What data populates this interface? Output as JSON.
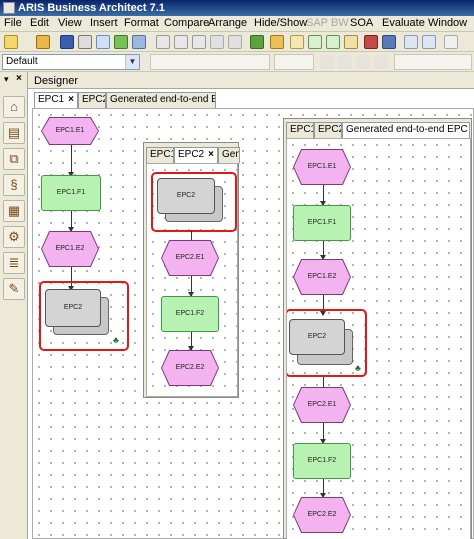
{
  "app": {
    "title": "ARIS Business Architect 7.1"
  },
  "menu": [
    "File",
    "Edit",
    "View",
    "Insert",
    "Format",
    "Compare",
    "Arrange",
    "Hide/Show",
    "SAP BW",
    "SOA",
    "Evaluate",
    "Window"
  ],
  "toolbar": {
    "database_combo": "Default"
  },
  "panel": {
    "title": "Designer"
  },
  "windows": {
    "left": {
      "tabs": [
        "EPC1",
        "EPC2",
        "Generated end-to-end EPC"
      ],
      "close_glyph": "×"
    },
    "middle": {
      "tabs": [
        "EPC1",
        "EPC2",
        "Genera"
      ],
      "close_glyph": "×"
    },
    "right": {
      "tabs": [
        "EPC1",
        "EPC2",
        "Generated end-to-end EPC"
      ],
      "close_glyph": "×"
    }
  },
  "models": {
    "epc1": {
      "nodes": [
        "EPC1.E1",
        "EPC1.F1",
        "EPC1.E2",
        "EPC2"
      ]
    },
    "epc2": {
      "nodes": [
        "EPC2",
        "EPC2.E1",
        "EPC1.F2",
        "EPC2.E2"
      ]
    },
    "generated": {
      "nodes": [
        "EPC1.E1",
        "EPC1.F1",
        "EPC1.E2",
        "EPC2",
        "EPC2.E1",
        "EPC1.F2",
        "EPC2.E2"
      ]
    }
  },
  "icons": [
    "home-icon",
    "table-icon",
    "hierarchy-icon",
    "symbol-icon",
    "matrix-icon",
    "gears-icon",
    "scroll-icon",
    "tools-icon"
  ],
  "colors": {
    "event": "#f2b3f0",
    "function": "#b8f2b3",
    "process": "#d4d4d4",
    "highlight": "#e01818"
  }
}
